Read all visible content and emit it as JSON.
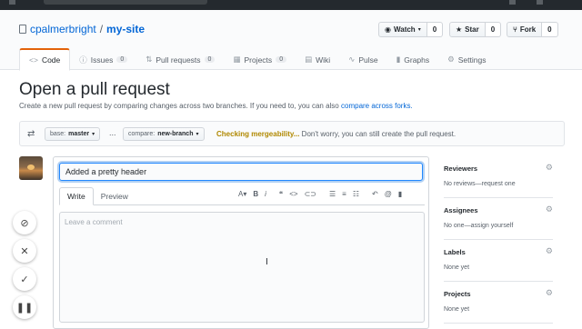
{
  "repo": {
    "owner": "cpalmerbright",
    "separator": "/",
    "name": "my-site"
  },
  "actions": {
    "watch": {
      "label": "Watch",
      "count": "0"
    },
    "star": {
      "label": "Star",
      "count": "0"
    },
    "fork": {
      "label": "Fork",
      "count": "0"
    }
  },
  "tabs": [
    {
      "label": "Code"
    },
    {
      "label": "Issues",
      "count": "0"
    },
    {
      "label": "Pull requests",
      "count": "0"
    },
    {
      "label": "Projects",
      "count": "0"
    },
    {
      "label": "Wiki"
    },
    {
      "label": "Pulse"
    },
    {
      "label": "Graphs"
    },
    {
      "label": "Settings"
    }
  ],
  "page": {
    "title": "Open a pull request",
    "subtitle": "Create a new pull request by comparing changes across two branches. If you need to, you can also",
    "subtitle_link": "compare across forks."
  },
  "range": {
    "base_prefix": "base:",
    "base": "master",
    "dots": "...",
    "compare_prefix": "compare:",
    "compare": "new-branch",
    "status": "Checking mergeability...",
    "status_detail": "Don't worry, you can still create the pull request."
  },
  "editor": {
    "title_value": "Added a pretty header",
    "write_tab": "Write",
    "preview_tab": "Preview",
    "placeholder": "Leave a comment"
  },
  "sidebar": [
    {
      "label": "Reviewers",
      "value": "No reviews—request one"
    },
    {
      "label": "Assignees",
      "value": "No one—assign yourself"
    },
    {
      "label": "Labels",
      "value": "None yet"
    },
    {
      "label": "Projects",
      "value": "None yet"
    }
  ],
  "colors": {
    "accent_link": "#0366d6",
    "active_tab_border": "#e36209",
    "checking": "#b08800"
  }
}
